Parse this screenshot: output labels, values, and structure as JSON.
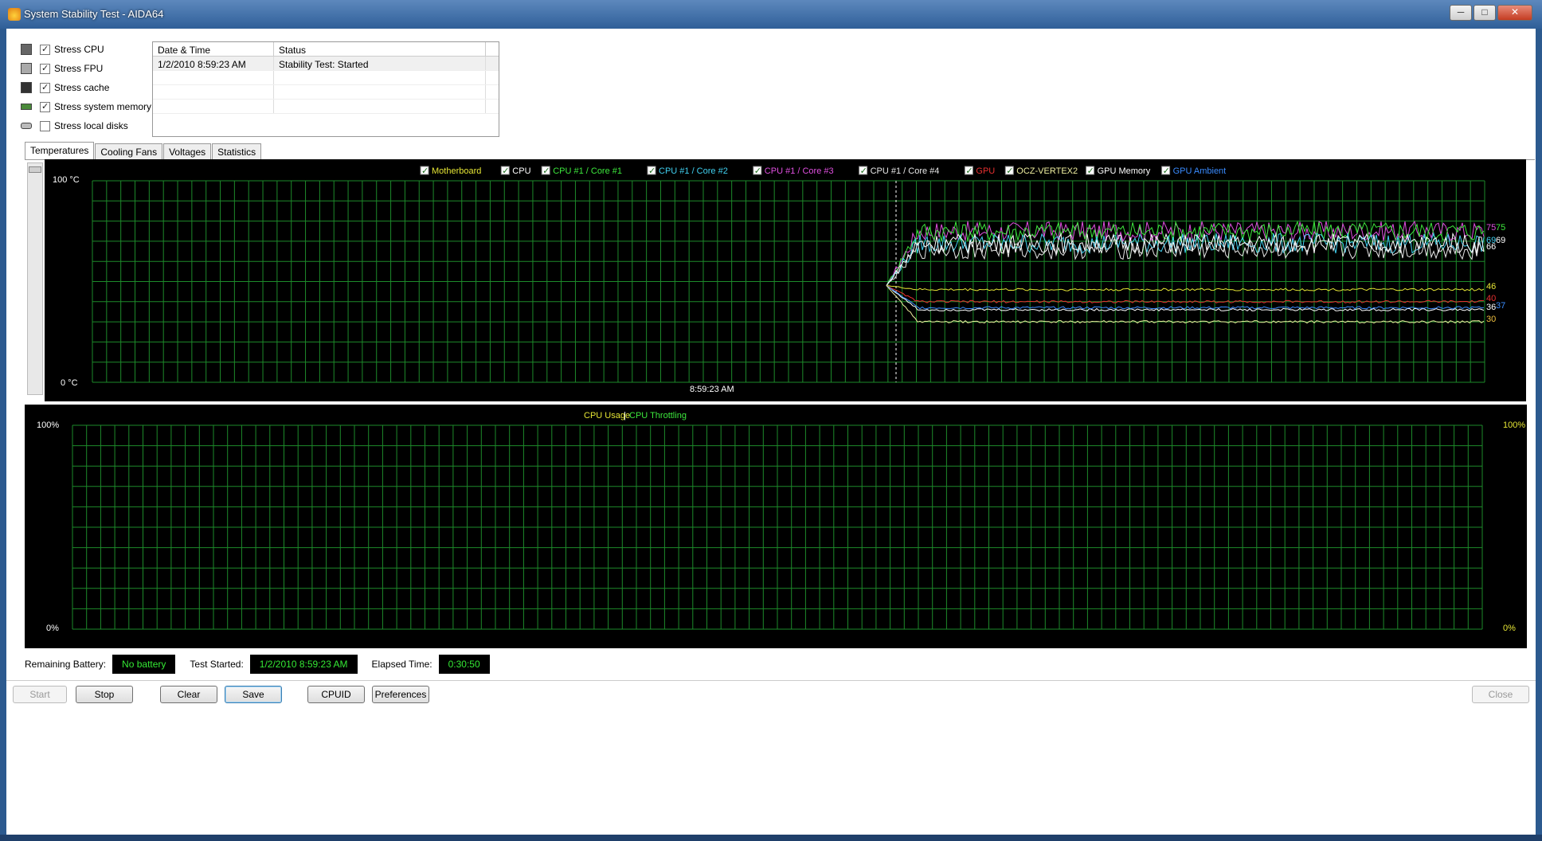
{
  "window": {
    "title": "System Stability Test - AIDA64",
    "minimize": "─",
    "maximize": "□",
    "close": "✕"
  },
  "stress_options": [
    {
      "label": "Stress CPU",
      "checked": true,
      "icon": "cpu-icon"
    },
    {
      "label": "Stress FPU",
      "checked": true,
      "icon": "fpu-icon"
    },
    {
      "label": "Stress cache",
      "checked": true,
      "icon": "cache-icon"
    },
    {
      "label": "Stress system memory",
      "checked": true,
      "icon": "memory-icon"
    },
    {
      "label": "Stress local disks",
      "checked": false,
      "icon": "disk-icon"
    }
  ],
  "log": {
    "col_datetime": "Date & Time",
    "col_status": "Status",
    "rows": [
      {
        "datetime": "1/2/2010 8:59:23 AM",
        "status": "Stability Test: Started"
      }
    ]
  },
  "tabs": [
    "Temperatures",
    "Cooling Fans",
    "Voltages",
    "Statistics"
  ],
  "temp_chart": {
    "y_max_label": "100 °C",
    "y_min_label": "0 °C",
    "x_marker_label": "8:59:23 AM",
    "legend": [
      {
        "name": "Motherboard",
        "color": "#e6e635"
      },
      {
        "name": "CPU",
        "color": "#ffffff"
      },
      {
        "name": "CPU #1 / Core #1",
        "color": "#3de83d"
      },
      {
        "name": "CPU #1 / Core #2",
        "color": "#40d0f0"
      },
      {
        "name": "CPU #1 / Core #3",
        "color": "#e050e0"
      },
      {
        "name": "CPU #1 / Core #4",
        "color": "#e8e8e8"
      },
      {
        "name": "GPU",
        "color": "#e83030"
      },
      {
        "name": "OCZ-VERTEX2",
        "color": "#f0f0a0"
      },
      {
        "name": "GPU Memory",
        "color": "#ffffff"
      },
      {
        "name": "GPU Ambient",
        "color": "#3a8cff"
      }
    ],
    "end_values": [
      {
        "text": "75",
        "color": "#e050e0"
      },
      {
        "text": "75",
        "color": "#3de83d"
      },
      {
        "text": "69",
        "color": "#40d0f0"
      },
      {
        "text": "69",
        "color": "#ffffff"
      },
      {
        "text": "66",
        "color": "#ffffff"
      },
      {
        "text": "46",
        "color": "#e6e635"
      },
      {
        "text": "40",
        "color": "#e83030"
      },
      {
        "text": "36",
        "color": "#ffffff"
      },
      {
        "text": "37",
        "color": "#3a8cff"
      },
      {
        "text": "30",
        "color": "#f0c040"
      }
    ]
  },
  "usage_chart": {
    "legend_usage": "CPU Usage",
    "legend_sep": "|",
    "legend_throttle": "CPU Throttling",
    "left_max": "100%",
    "left_min": "0%",
    "right_max": "100%",
    "right_min": "0%"
  },
  "status": {
    "battery_label": "Remaining Battery:",
    "battery_value": "No battery",
    "started_label": "Test Started:",
    "started_value": "1/2/2010 8:59:23 AM",
    "elapsed_label": "Elapsed Time:",
    "elapsed_value": "0:30:50"
  },
  "buttons": {
    "start": "Start",
    "stop": "Stop",
    "clear": "Clear",
    "save": "Save",
    "cpuid": "CPUID",
    "preferences": "Preferences",
    "close": "Close"
  },
  "chart_data": [
    {
      "type": "line",
      "title": "",
      "ylabel": "°C",
      "ylim": [
        0,
        100
      ],
      "x_marker": "8:59:23 AM",
      "series": [
        {
          "name": "CPU #1 / Core #3",
          "end": 75
        },
        {
          "name": "CPU #1 / Core #1",
          "end": 75
        },
        {
          "name": "CPU #1 / Core #2",
          "end": 69
        },
        {
          "name": "CPU",
          "end": 69
        },
        {
          "name": "CPU #1 / Core #4",
          "end": 66
        },
        {
          "name": "Motherboard",
          "end": 46
        },
        {
          "name": "GPU",
          "end": 40
        },
        {
          "name": "GPU Memory",
          "end": 36
        },
        {
          "name": "GPU Ambient",
          "end": 37
        },
        {
          "name": "OCZ-VERTEX2",
          "end": 30
        }
      ]
    },
    {
      "type": "line",
      "title": "",
      "ylim": [
        0,
        100
      ],
      "series": [
        {
          "name": "CPU Usage",
          "values": []
        },
        {
          "name": "CPU Throttling",
          "values": []
        }
      ]
    }
  ]
}
